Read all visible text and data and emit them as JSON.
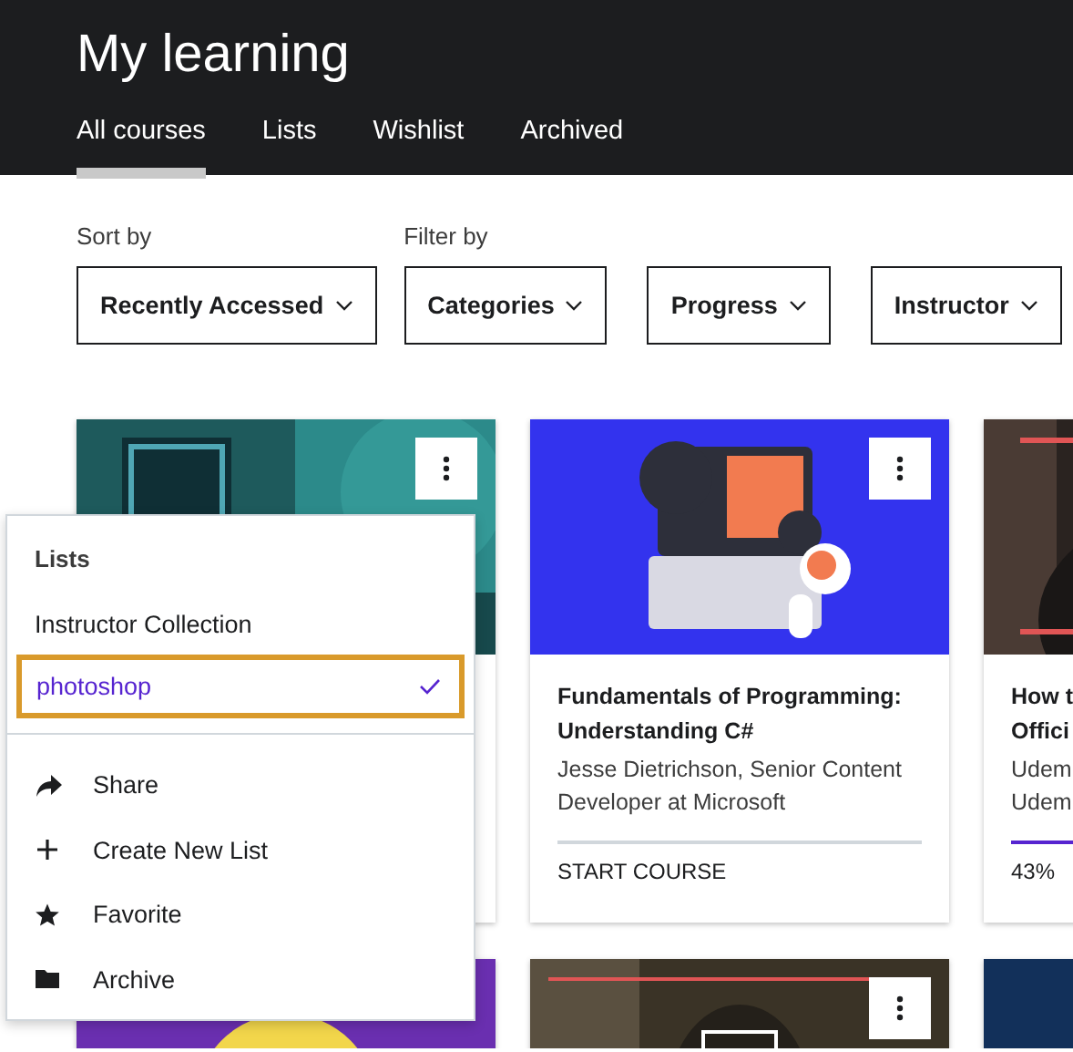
{
  "header": {
    "title": "My learning",
    "tabs": [
      {
        "label": "All courses",
        "selected": true
      },
      {
        "label": "Lists",
        "selected": false
      },
      {
        "label": "Wishlist",
        "selected": false
      },
      {
        "label": "Archived",
        "selected": false
      }
    ]
  },
  "sort": {
    "label": "Sort by",
    "value": "Recently Accessed"
  },
  "filter": {
    "label": "Filter by",
    "options": [
      "Categories",
      "Progress",
      "Instructor"
    ]
  },
  "courses": [
    {
      "menu_button": true
    },
    {
      "title": "Fundamentals of Programming:\nUnderstanding C#",
      "instructor": "Jesse Dietrichson, Senior Content\nDeveloper at Microsoft",
      "progress_label": "START COURSE",
      "level": 0,
      "menu_button": true
    },
    {
      "title": "How t\nOffici",
      "instructor": "Udem\nUdem",
      "progress_label": "43%",
      "level": 0.43,
      "menu_button": false
    },
    {
      "menu_button": false
    },
    {
      "menu_button": true
    },
    {
      "menu_button": false
    }
  ],
  "menu": {
    "heading": "Lists",
    "lists": [
      {
        "label": "Instructor Collection",
        "selected": false
      },
      {
        "label": "photoshop",
        "selected": true
      }
    ],
    "actions": [
      {
        "label": "Share",
        "kind": "share"
      },
      {
        "label": "Create New List",
        "kind": "create"
      },
      {
        "label": "Favorite",
        "kind": "favorite"
      },
      {
        "label": "Archive",
        "kind": "archive"
      }
    ]
  }
}
